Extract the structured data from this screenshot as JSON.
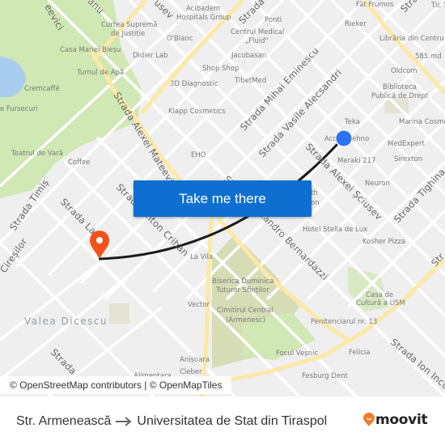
{
  "map": {
    "district_label": "Valea Dicescu",
    "streets": [
      {
        "id": "mateevici-top",
        "text": "eevici"
      },
      {
        "id": "top-anu",
        "text": "anu"
      },
      {
        "id": "sciusev-top",
        "text": "usev"
      },
      {
        "id": "strada-top-mid",
        "text": "Strada"
      },
      {
        "id": "strada-top-right",
        "text": "Strada"
      },
      {
        "id": "alexei-mateevici",
        "text": "Strada Alexei Mateevici"
      },
      {
        "id": "mihai-eminescu",
        "text": "Strada Mihai Eminescu"
      },
      {
        "id": "vasile-alecsandri",
        "text": "Strada Vasile Alecsandri"
      },
      {
        "id": "alexei-sciusev",
        "text": "Strada Alexei Șciusev"
      },
      {
        "id": "tighina",
        "text": "Strada Tighina"
      },
      {
        "id": "anton-crihan",
        "text": "Strada Anton Crihan"
      },
      {
        "id": "alexandro-bernardazzi",
        "text": "Strada Alexandro Bernardazzi"
      },
      {
        "id": "timis",
        "text": "Strada Timiș"
      },
      {
        "id": "strada-la",
        "text": "Strada La"
      },
      {
        "id": "ciresilor",
        "text": "Cireșilor"
      },
      {
        "id": "ion-inculet",
        "text": "Strada Ion Inculeț"
      },
      {
        "id": "strada-bottom-left",
        "text": "Strada"
      },
      {
        "id": "strada-right-edge",
        "text": "Str"
      }
    ],
    "pois": [
      {
        "id": "acibadem",
        "text": "Acibadem"
      },
      {
        "id": "acibadem2",
        "text": "Hospitals Group"
      },
      {
        "id": "curtea1",
        "text": "Curtea Supremă"
      },
      {
        "id": "curtea2",
        "text": "de Justiție"
      },
      {
        "id": "oblanc",
        "text": "O'Blanc"
      },
      {
        "id": "casa-biesu",
        "text": "Casa Mariei Bieșu"
      },
      {
        "id": "didier",
        "text": "Didier Lab"
      },
      {
        "id": "tumul",
        "text": "Turnul de Apă"
      },
      {
        "id": "shopshop",
        "text": "Shop Shop"
      },
      {
        "id": "3d",
        "text": "3D Diagnostic"
      },
      {
        "id": "cremcaffe",
        "text": "Cremcaffé"
      },
      {
        "id": "fursecuri",
        "text": "e Fursecuri"
      },
      {
        "id": "klapp",
        "text": "Klapp Cosmetics"
      },
      {
        "id": "teatrul",
        "text": "Teatrul de Vară"
      },
      {
        "id": "coffee",
        "text": "Coffee"
      },
      {
        "id": "eho",
        "text": "EHO"
      },
      {
        "id": "ponti",
        "text": "Ponti"
      },
      {
        "id": "fluid1",
        "text": "Centrul Medical"
      },
      {
        "id": "fluid2",
        "text": "„Fluid\""
      },
      {
        "id": "jacobasan",
        "text": "Jacobasan"
      },
      {
        "id": "tibetmed",
        "text": "TibetMed"
      },
      {
        "id": "fat-frumos",
        "text": "Făt Frumos"
      },
      {
        "id": "tic",
        "text": "Tic T"
      },
      {
        "id": "rieker",
        "text": "Rieker"
      },
      {
        "id": "libraria",
        "text": "Librăria din Centru"
      },
      {
        "id": "585",
        "text": "585.md"
      },
      {
        "id": "oldcom",
        "text": "Oldcom"
      },
      {
        "id": "biblio1",
        "text": "Biblioteca"
      },
      {
        "id": "biblio2",
        "text": "Publică de Drept"
      },
      {
        "id": "teka",
        "text": "Teka"
      },
      {
        "id": "acc",
        "text": "Acc"
      },
      {
        "id": "ehno",
        "text": "ehno"
      },
      {
        "id": "marina",
        "text": "Marina Cosme"
      },
      {
        "id": "medexpert",
        "text": "MedExpert"
      },
      {
        "id": "meraki",
        "text": "Meraki 217"
      },
      {
        "id": "sirexton",
        "text": "Sirexton"
      },
      {
        "id": "neuron",
        "text": "Neuron"
      },
      {
        "id": "th",
        "text": "th"
      },
      {
        "id": "on",
        "text": "on"
      },
      {
        "id": "stella",
        "text": "Hotel Stella de Lux"
      },
      {
        "id": "kosher",
        "text": "Kosher Pizza"
      },
      {
        "id": "lavila",
        "text": "La Vila"
      },
      {
        "id": "biserica1",
        "text": "Biserica Duminica"
      },
      {
        "id": "biserica2",
        "text": "Tuturor Sfinților"
      },
      {
        "id": "cimitir1",
        "text": "Cimitirul Central"
      },
      {
        "id": "cimitir2",
        "text": "(Armenesc)"
      },
      {
        "id": "vector",
        "text": "Vector"
      },
      {
        "id": "casa-cult1",
        "text": "Casa de"
      },
      {
        "id": "casa-cult2",
        "text": "Cultură a USM"
      },
      {
        "id": "peniten",
        "text": "Penitenciarul nr. 13"
      },
      {
        "id": "focul",
        "text": "Focul Veșnic"
      },
      {
        "id": "felicia",
        "text": "Felicia"
      },
      {
        "id": "anisoara",
        "text": "Anișoara"
      },
      {
        "id": "cleber",
        "text": "Cleber"
      },
      {
        "id": "alimentara",
        "text": "Alimentara"
      },
      {
        "id": "fesburg",
        "text": "Fesburg Dent"
      }
    ],
    "colors": {
      "background": "#efefef",
      "road": "#ffffff",
      "major_road": "#fbe9a6",
      "park": "#cfe8b4",
      "cemetery": "#d6ddb5",
      "water": "#a9cdee",
      "route_line": "#1a1a1a",
      "origin_marker": "#f2511b",
      "destination_marker": "#2b73f0"
    }
  },
  "take_me_there": {
    "label": "Take me there",
    "color": "#0f6fd0"
  },
  "attribution": "© OpenStreetMap contributors | © OpenMapTiles",
  "footer": {
    "origin": "Str. Armenească",
    "destination": "Universitatea de Stat din Tiraspol",
    "brand": "moovit",
    "brand_color": "#f47c20"
  }
}
